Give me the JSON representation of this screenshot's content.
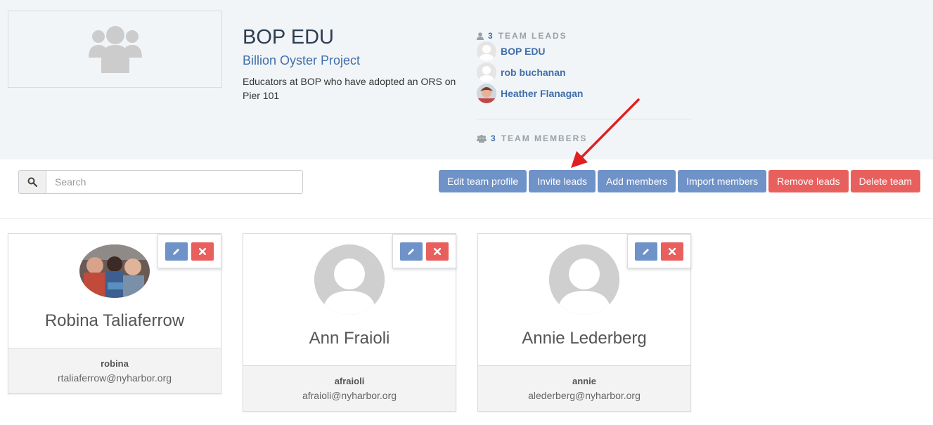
{
  "team": {
    "name": "BOP EDU",
    "organization": "Billion Oyster Project",
    "description": "Educators at BOP who have adopted an ORS on Pier 101"
  },
  "leads": {
    "count": "3",
    "label": "TEAM LEADS",
    "items": [
      {
        "name": "BOP EDU"
      },
      {
        "name": "rob buchanan"
      },
      {
        "name": "Heather Flanagan"
      }
    ]
  },
  "members": {
    "count": "3",
    "label": "TEAM MEMBERS"
  },
  "search": {
    "placeholder": "Search"
  },
  "toolbar": {
    "edit_profile": "Edit team profile",
    "invite_leads": "Invite leads",
    "add_members": "Add members",
    "import_members": "Import members",
    "remove_leads": "Remove leads",
    "delete_team": "Delete team"
  },
  "cards": [
    {
      "name": "Robina Taliaferrow",
      "username": "robina",
      "email": "rtaliaferrow@nyharbor.org"
    },
    {
      "name": "Ann Fraioli",
      "username": "afraioli",
      "email": "afraioli@nyharbor.org"
    },
    {
      "name": "Annie Lederberg",
      "username": "annie",
      "email": "alederberg@nyharbor.org"
    }
  ],
  "colors": {
    "primary_button": "#6f92c8",
    "danger_button": "#e8605e",
    "link": "#3f6fab",
    "header_bg": "#f2f5f7",
    "annotation_arrow": "#e02020"
  },
  "icons": {
    "team_placeholder": "users-icon",
    "search": "search-icon",
    "edit": "pencil-icon",
    "delete": "close-icon",
    "leads_heading": "user-icon",
    "members_heading": "users-icon"
  }
}
